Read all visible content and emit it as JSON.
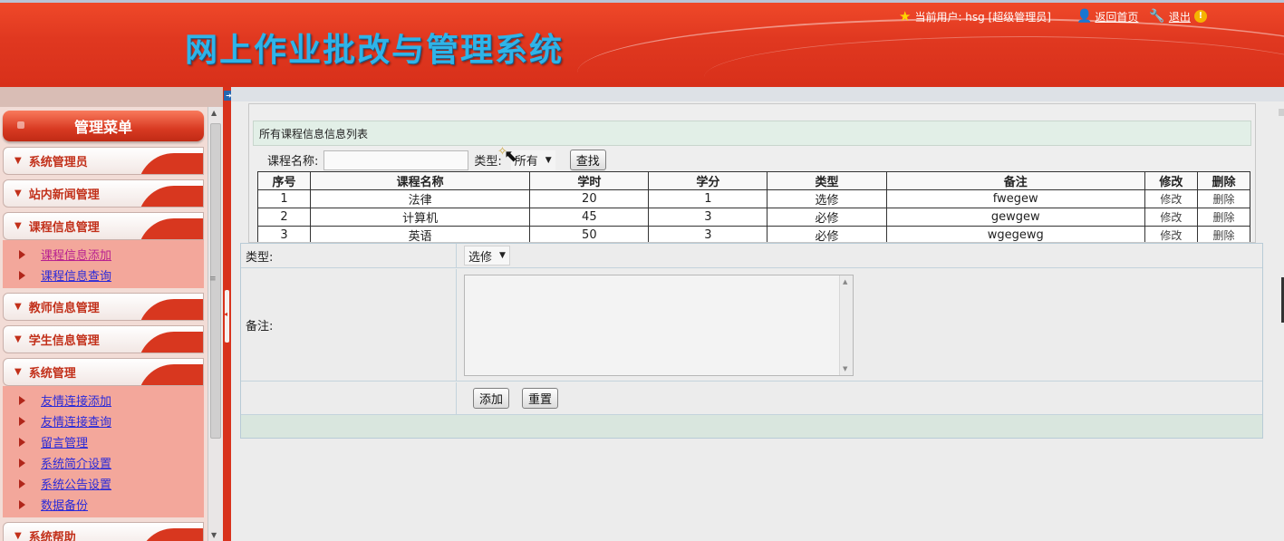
{
  "header": {
    "system_title": "网上作业批改与管理系统",
    "current_user_text": "当前用户: hsg [超级管理员]",
    "home_link": "返回首页",
    "logout_link": "退出"
  },
  "sidebar": {
    "menu_title": "管理菜单",
    "sections": [
      {
        "title": "系统管理员",
        "items": []
      },
      {
        "title": "站内新闻管理",
        "items": []
      },
      {
        "title": "课程信息管理",
        "items": [
          "课程信息添加",
          "课程信息查询"
        ]
      },
      {
        "title": "教师信息管理",
        "items": []
      },
      {
        "title": "学生信息管理",
        "items": []
      },
      {
        "title": "系统管理",
        "items": [
          "友情连接添加",
          "友情连接查询",
          "留言管理",
          "系统简介设置",
          "系统公告设置",
          "数据备份"
        ]
      },
      {
        "title": "系统帮助",
        "items": []
      }
    ]
  },
  "list": {
    "title": "所有课程信息信息列表",
    "search_label": "课程名称:",
    "search_value": "",
    "type_label": "类型:",
    "type_selected": "所有",
    "search_button": "查找",
    "columns": [
      "序号",
      "课程名称",
      "学时",
      "学分",
      "类型",
      "备注",
      "修改",
      "删除"
    ],
    "rows": [
      [
        "1",
        "法律",
        "20",
        "1",
        "选修",
        "fwegew",
        "修改",
        "删除"
      ],
      [
        "2",
        "计算机",
        "45",
        "3",
        "必修",
        "gewgew",
        "修改",
        "删除"
      ],
      [
        "3",
        "英语",
        "50",
        "3",
        "必修",
        "wgegewg",
        "修改",
        "删除"
      ]
    ]
  },
  "form": {
    "type_label": "类型:",
    "type_selected": "选修",
    "remark_label": "备注:",
    "remark_value": "",
    "add_button": "添加",
    "reset_button": "重置"
  },
  "colors": {
    "header_red": "#e03820",
    "title_blue": "#2fb4e8",
    "menu_red": "#d8371f",
    "link_blue": "#2b2bd8",
    "submenu_bg": "#f3a79b"
  }
}
